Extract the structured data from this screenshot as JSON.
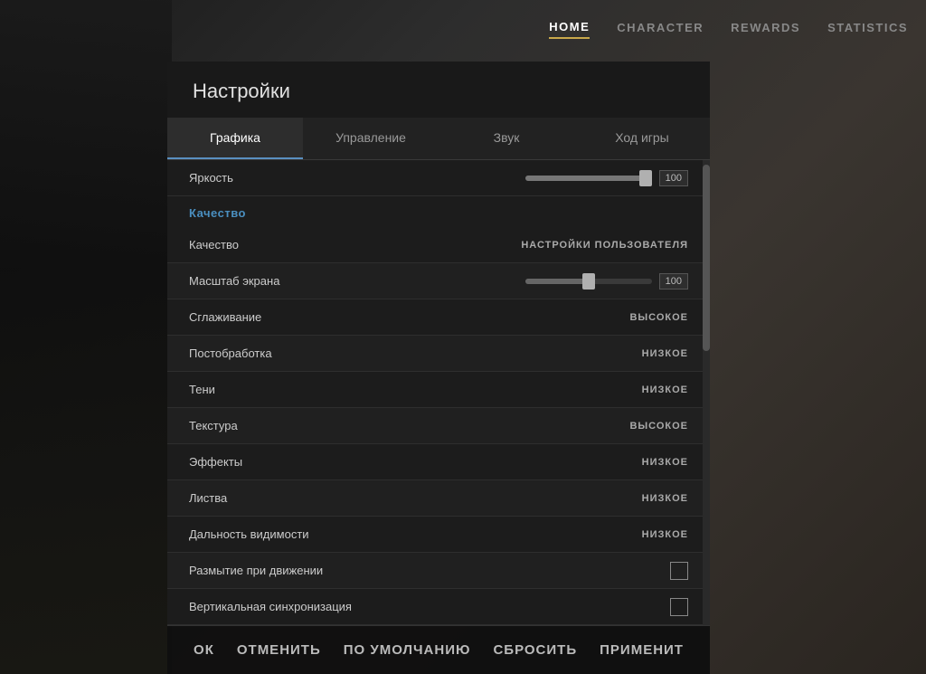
{
  "nav": {
    "items": [
      {
        "label": "HOME",
        "active": true
      },
      {
        "label": "CHARACTER",
        "active": false
      },
      {
        "label": "REWARDS",
        "active": false
      },
      {
        "label": "STATISTICS",
        "active": false
      }
    ]
  },
  "settings": {
    "title": "Настройки",
    "tabs": [
      {
        "label": "Графика",
        "active": true
      },
      {
        "label": "Управление",
        "active": false
      },
      {
        "label": "Звук",
        "active": false
      },
      {
        "label": "Ход игры",
        "active": false
      }
    ],
    "brightness": {
      "label": "Яркость",
      "value": "100"
    },
    "quality_section": {
      "title": "Качество"
    },
    "rows": [
      {
        "label": "Качество",
        "value": "НАСТРОЙКИ ПОЛЬЗОВАТЕЛЯ",
        "type": "text"
      },
      {
        "label": "Масштаб экрана",
        "value": "100",
        "type": "slider_mid"
      },
      {
        "label": "Сглаживание",
        "value": "ВЫСОКОЕ",
        "type": "text"
      },
      {
        "label": "Постобработка",
        "value": "НИЗКОЕ",
        "type": "text"
      },
      {
        "label": "Тени",
        "value": "НИЗКОЕ",
        "type": "text"
      },
      {
        "label": "Текстура",
        "value": "ВЫСОКОЕ",
        "type": "text"
      },
      {
        "label": "Эффекты",
        "value": "НИЗКОЕ",
        "type": "text"
      },
      {
        "label": "Листва",
        "value": "НИЗКОЕ",
        "type": "text"
      },
      {
        "label": "Дальность видимости",
        "value": "НИЗКОЕ",
        "type": "text"
      },
      {
        "label": "Размытие при движении",
        "value": "",
        "type": "checkbox"
      },
      {
        "label": "Вертикальная синхронизация",
        "value": "",
        "type": "checkbox"
      }
    ],
    "bottom_buttons": [
      {
        "label": "ОК"
      },
      {
        "label": "ОТМЕНИТЬ"
      },
      {
        "label": "ПО УМОЛЧАНИЮ"
      },
      {
        "label": "СБРОСИТЬ"
      },
      {
        "label": "ПРИМЕНИТ"
      }
    ]
  }
}
